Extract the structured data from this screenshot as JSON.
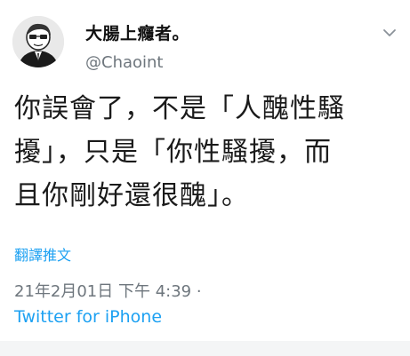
{
  "author": {
    "display_name": "大腸上癮者。",
    "handle": "@Chaoint"
  },
  "tweet": {
    "lines": [
      "你誤會了，不是「人醜性騷",
      "擾」，只是「你性騷擾，而",
      "且你剛好還很醜」。"
    ]
  },
  "actions": {
    "translate_label": "翻譯推文"
  },
  "meta": {
    "timestamp": "21年2月01日 下午 4:39 ·",
    "source": "Twitter for iPhone"
  },
  "colors": {
    "link": "#1da1f2",
    "secondary_text": "#6e767d",
    "primary_text": "#1a1a1a"
  },
  "icons": {
    "avatar": "avatar-image",
    "menu": "chevron-down-icon"
  }
}
